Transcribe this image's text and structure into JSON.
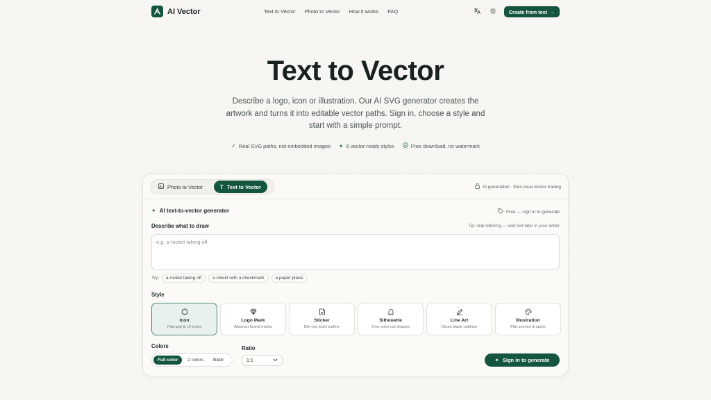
{
  "brand": {
    "name": "AI Vector"
  },
  "nav": {
    "links": [
      "Text to Vector",
      "Photo to Vector",
      "How it works",
      "FAQ"
    ],
    "translate_icon": "translate-icon",
    "theme_icon": "sun-icon",
    "cta_label": "Create from text"
  },
  "hero": {
    "title": "Text to Vector",
    "subtitle": "Describe a logo, icon or illustration. Our AI SVG generator creates the artwork and turns it into editable vector paths. Sign in, choose a style and start with a simple prompt.",
    "features": [
      {
        "icon": "check-icon",
        "label": "Real SVG paths, not embedded images"
      },
      {
        "icon": "sparkle-icon",
        "label": "6 vector-ready styles"
      },
      {
        "icon": "check-circle-icon",
        "label": "Free download, no watermark"
      }
    ]
  },
  "card": {
    "tabs": [
      {
        "label": "Photo to Vector",
        "icon": "image-icon"
      },
      {
        "label": "Text to Vector",
        "icon": "text-icon",
        "active": true
      }
    ],
    "ai_note": "AI generation · then local vector tracing",
    "generator_title": "AI text-to-vector generator",
    "free_note": "Free — sign in to generate",
    "prompt_label": "Describe what to draw",
    "prompt_tip": "Tip: skip lettering — add text later in your editor",
    "prompt_placeholder": "e.g. a rocket taking off",
    "try_label": "Try:",
    "try_chips": [
      "a rocket taking off",
      "a shield with a checkmark",
      "a paper plane"
    ],
    "style_label": "Style",
    "styles": [
      {
        "name": "Icon",
        "desc": "Flat app & UI icons",
        "icon": "hexagon-icon",
        "selected": true
      },
      {
        "name": "Logo Mark",
        "desc": "Abstract brand marks",
        "icon": "gem-icon"
      },
      {
        "name": "Sticker",
        "desc": "Die-cut, bold outline",
        "icon": "sticker-icon"
      },
      {
        "name": "Silhouette",
        "desc": "One-color cut shapes",
        "icon": "ghost-icon"
      },
      {
        "name": "Line Art",
        "desc": "Clean black outlines",
        "icon": "pen-icon"
      },
      {
        "name": "Illustration",
        "desc": "Flat scenes & spots",
        "icon": "palette-icon"
      }
    ],
    "colors_label": "Colors",
    "color_options": [
      "Full color",
      "2 colors",
      "B&W"
    ],
    "color_selected": "Full color",
    "ratio_label": "Ratio",
    "ratio_value": "1:1",
    "generate_label": "Sign in to generate"
  },
  "colors": {
    "accent": "#14553f",
    "selected_bg": "#e8f1ec"
  }
}
